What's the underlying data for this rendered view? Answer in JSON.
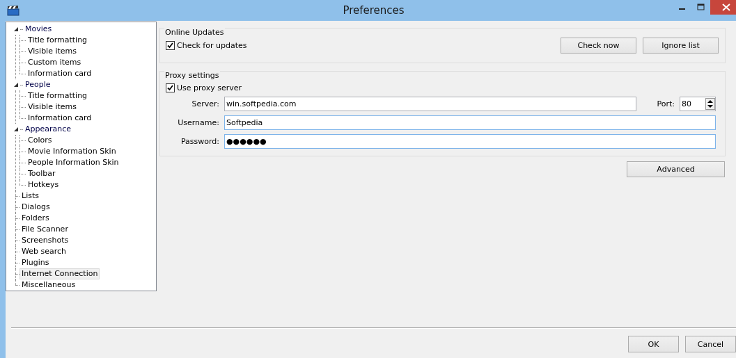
{
  "window": {
    "title": "Preferences"
  },
  "sidebar": {
    "items": [
      {
        "label": "Movies",
        "selected": false,
        "expanded": true,
        "children": [
          {
            "label": "Title formatting",
            "selected": false
          },
          {
            "label": "Visible items",
            "selected": false
          },
          {
            "label": "Custom items",
            "selected": false
          },
          {
            "label": "Information card",
            "selected": false
          }
        ]
      },
      {
        "label": "People",
        "selected": false,
        "expanded": true,
        "children": [
          {
            "label": "Title formatting",
            "selected": false
          },
          {
            "label": "Visible items",
            "selected": false
          },
          {
            "label": "Information card",
            "selected": false
          }
        ]
      },
      {
        "label": "Appearance",
        "selected": false,
        "expanded": true,
        "children": [
          {
            "label": "Colors",
            "selected": false
          },
          {
            "label": "Movie Information Skin",
            "selected": false
          },
          {
            "label": "People Information Skin",
            "selected": false
          },
          {
            "label": "Toolbar",
            "selected": false
          },
          {
            "label": "Hotkeys",
            "selected": false
          }
        ]
      },
      {
        "label": "Lists",
        "selected": false
      },
      {
        "label": "Dialogs",
        "selected": false
      },
      {
        "label": "Folders",
        "selected": false
      },
      {
        "label": "File Scanner",
        "selected": false
      },
      {
        "label": "Screenshots",
        "selected": false
      },
      {
        "label": "Web search",
        "selected": false
      },
      {
        "label": "Plugins",
        "selected": false
      },
      {
        "label": "Internet Connection",
        "selected": true
      },
      {
        "label": "Miscellaneous",
        "selected": false
      }
    ]
  },
  "online_updates": {
    "title": "Online Updates",
    "check_for_updates": {
      "label": "Check for updates",
      "checked": true
    },
    "buttons": [
      "Check now",
      "Ignore list"
    ]
  },
  "proxy_settings": {
    "title": "Proxy settings",
    "use_proxy": {
      "label": "Use proxy server",
      "checked": true
    },
    "server": {
      "label": "Server:",
      "value": "win.softpedia.com"
    },
    "port": {
      "label": "Port:",
      "value": "80"
    },
    "username": {
      "label": "Username:",
      "value": "Softpedia"
    },
    "password": {
      "label": "Password:",
      "value": "●●●●●●"
    }
  },
  "advanced_button": "Advanced",
  "buttons": [
    "OK",
    "Cancel"
  ]
}
